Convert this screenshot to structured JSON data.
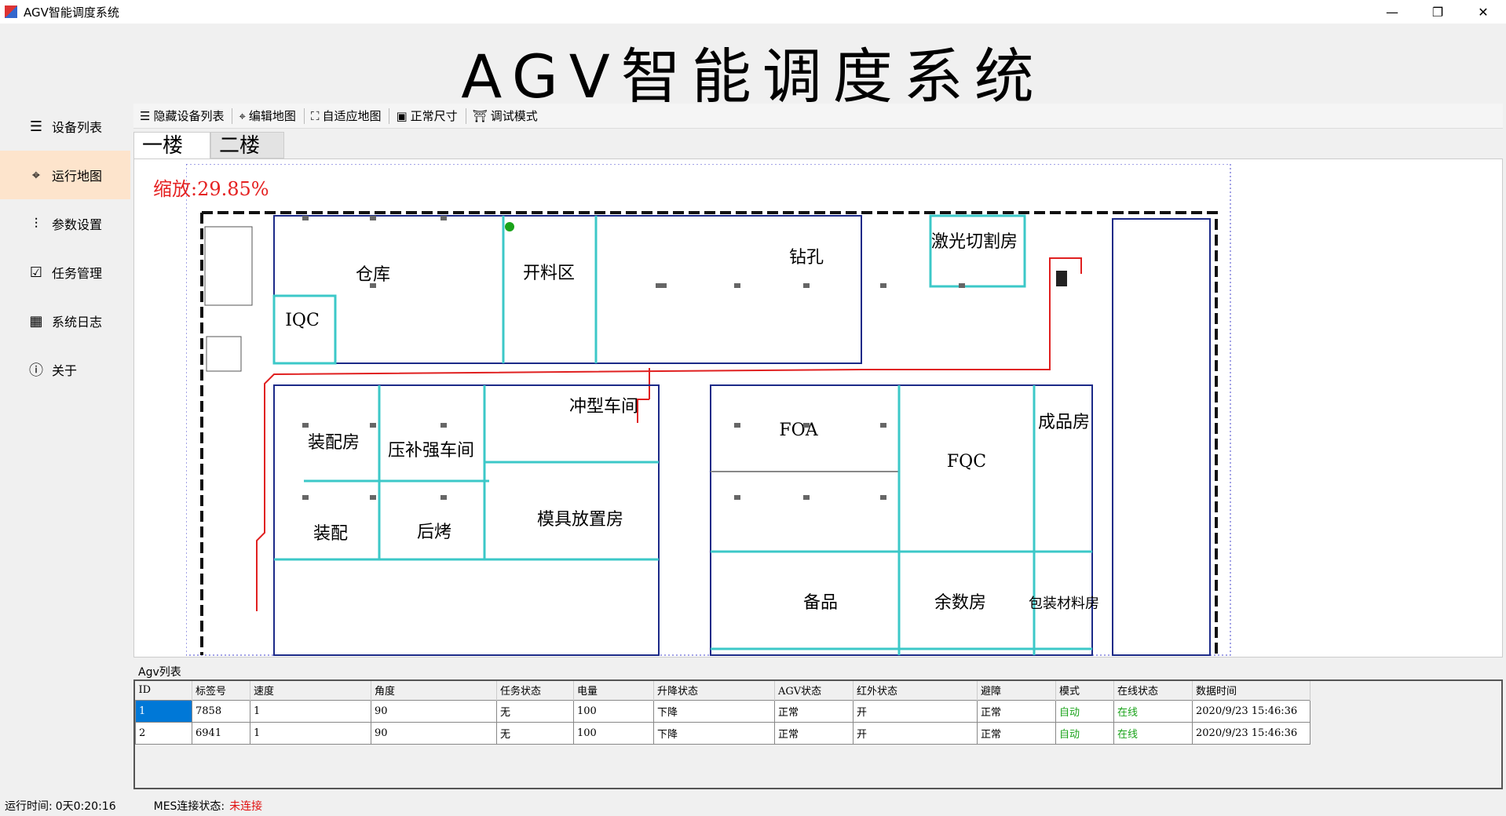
{
  "window": {
    "title": "AGV智能调度系统",
    "controls": [
      "—",
      "❐",
      "✕"
    ]
  },
  "header": {
    "title": "AGV智能调度系统"
  },
  "sidebar": {
    "items": [
      {
        "label": "设备列表",
        "icon": "list-icon"
      },
      {
        "label": "运行地图",
        "icon": "map-pin-icon",
        "active": true
      },
      {
        "label": "参数设置",
        "icon": "sliders-icon"
      },
      {
        "label": "任务管理",
        "icon": "clipboard-icon"
      },
      {
        "label": "系统日志",
        "icon": "calendar-icon"
      },
      {
        "label": "关于",
        "icon": "info-icon"
      }
    ]
  },
  "toolbar": {
    "hide_devices": "隐藏设备列表",
    "edit_map": "编辑地图",
    "fit_map": "自适应地图",
    "normal_size": "正常尺寸",
    "debug_mode": "调试模式"
  },
  "tabs": [
    "一楼",
    "二楼"
  ],
  "map": {
    "zoom": "缩放:29.85%",
    "rooms": [
      "仓库",
      "开料区",
      "钻孔",
      "激光切割房",
      "IQC",
      "冲型车间",
      "装配房",
      "压补强车间",
      "FOA",
      "成品房",
      "FQC",
      "模具放置房",
      "装配",
      "后烤",
      "备品",
      "余数房",
      "包装材料房"
    ]
  },
  "agv_list": {
    "title": "Agv列表",
    "columns": [
      "ID",
      "标签号",
      "速度",
      "角度",
      "任务状态",
      "电量",
      "升降状态",
      "AGV状态",
      "红外状态",
      "避障",
      "模式",
      "在线状态",
      "数据时间"
    ],
    "rows": [
      [
        "1",
        "7858",
        "1",
        "90",
        "无",
        "100",
        "下降",
        "正常",
        "开",
        "正常",
        "自动",
        "在线",
        "2020/9/23 15:46:36"
      ],
      [
        "2",
        "6941",
        "1",
        "90",
        "无",
        "100",
        "下降",
        "正常",
        "开",
        "正常",
        "自动",
        "在线",
        "2020/9/23 15:46:36"
      ]
    ]
  },
  "status": {
    "runtime_label": "运行时间:",
    "runtime_value": "0天0:20:16",
    "mes_label": "MES连接状态:",
    "mes_value": "未连接"
  },
  "colors": {
    "accent_nav": "#fde4cc",
    "zoom_text": "#e52222",
    "online": "#1aa31a",
    "selected_cell": "#0078d7",
    "cyan_line": "#3cc8c8",
    "red_route": "#e02020"
  }
}
